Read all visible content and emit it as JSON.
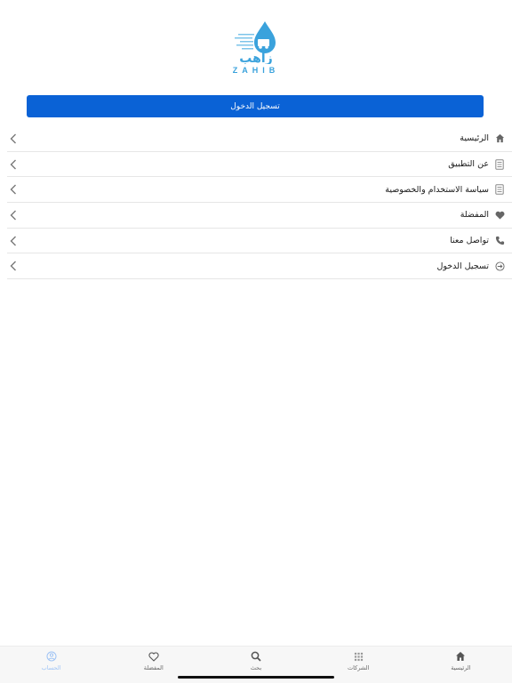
{
  "logo": {
    "arabic": "زاهب",
    "latin": "ZAHIB"
  },
  "login_button": {
    "label": "تسجيل الدخول"
  },
  "menu": {
    "items": [
      {
        "label": "الرئيسية",
        "icon": "home-icon"
      },
      {
        "label": "عن التطبيق",
        "icon": "document-icon"
      },
      {
        "label": "سياسة الاستخدام والخصوصية",
        "icon": "document-icon"
      },
      {
        "label": "المفضلة",
        "icon": "heart-filled-icon"
      },
      {
        "label": "تواصل معنا",
        "icon": "phone-icon"
      },
      {
        "label": "تسجيل الدخول",
        "icon": "sign-in-icon"
      }
    ]
  },
  "tabbar": {
    "tabs": [
      {
        "label": "الرئيسية",
        "icon": "home-icon",
        "active": false
      },
      {
        "label": "الشركات",
        "icon": "grid-icon",
        "active": false
      },
      {
        "label": "بحث",
        "icon": "search-icon",
        "active": false
      },
      {
        "label": "المفضلة",
        "icon": "heart-outline-icon",
        "active": false
      },
      {
        "label": "الحساب",
        "icon": "account-icon",
        "active": true
      }
    ]
  },
  "colors": {
    "primary": "#0a62d6",
    "logo_blue": "#3aa2dc",
    "active_tab": "#9ec3f5"
  }
}
